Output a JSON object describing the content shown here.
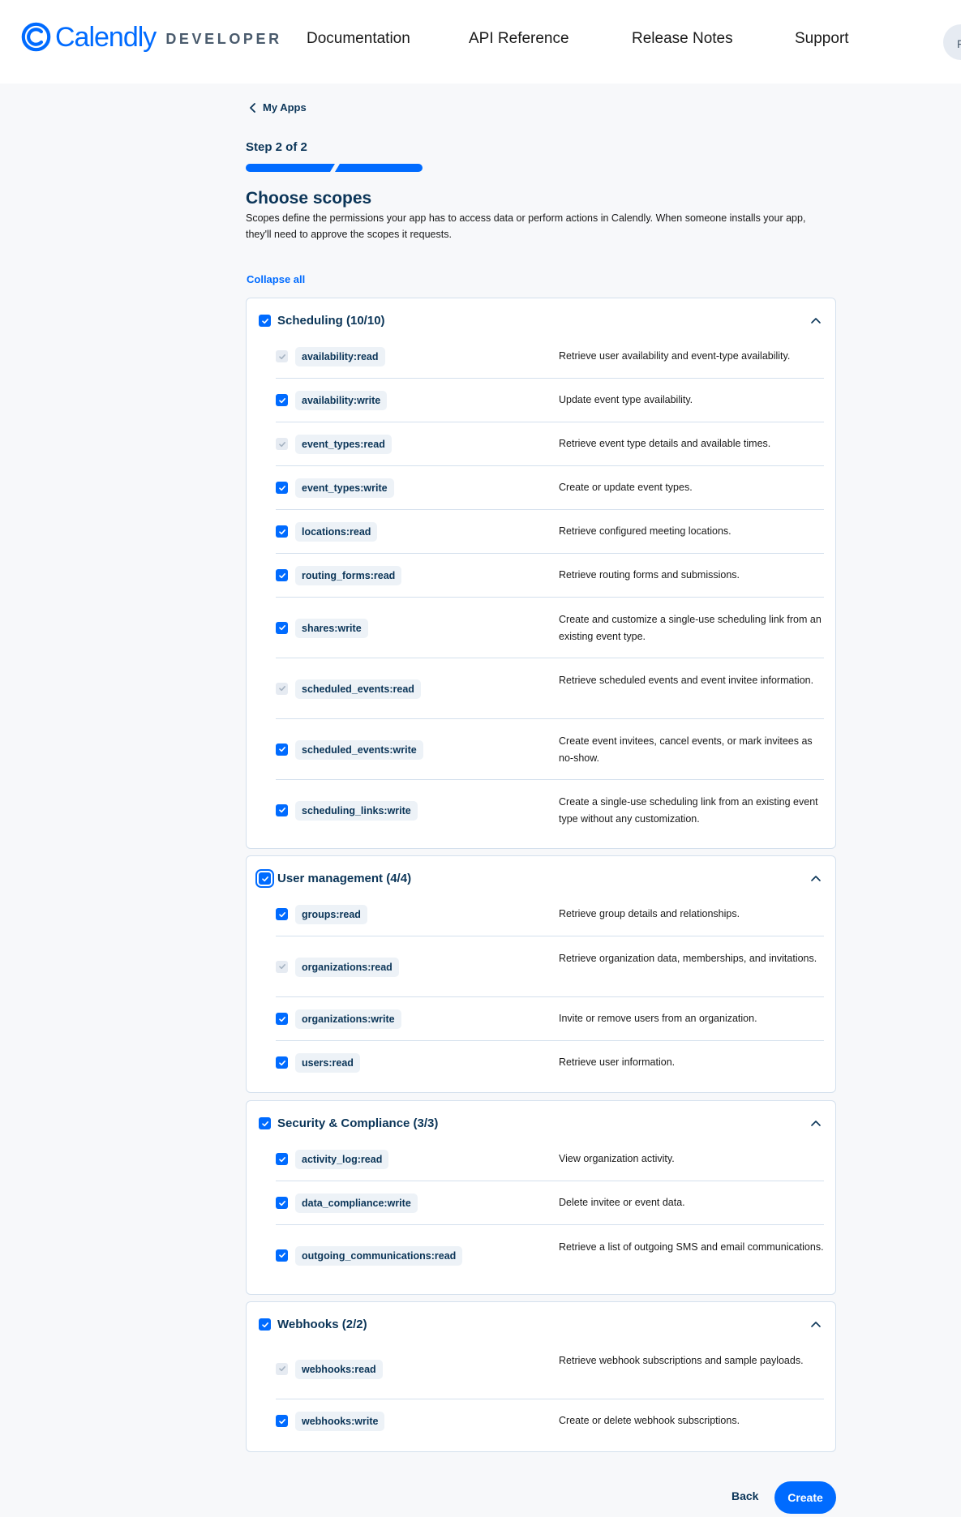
{
  "header": {
    "brand": "Calendly",
    "brand_suffix": "DEVELOPER",
    "nav": [
      "Documentation",
      "API Reference",
      "Release Notes",
      "Support"
    ],
    "avatar_initial": "F"
  },
  "breadcrumb": {
    "back_label": "My Apps"
  },
  "step": {
    "label": "Step 2 of 2",
    "current": 2,
    "total": 2
  },
  "page": {
    "title": "Choose scopes",
    "description": "Scopes define the permissions your app has to access data or perform actions in Calendly. When someone installs your app, they'll need to approve the scopes it requests.",
    "collapse_all": "Collapse all"
  },
  "sections": [
    {
      "title": "Scheduling (10/10)",
      "checked": true,
      "expanded": true,
      "scopes": [
        {
          "name": "availability:read",
          "description": "Retrieve user availability and event-type availability.",
          "checked": true,
          "disabled": true
        },
        {
          "name": "availability:write",
          "description": "Update event type availability.",
          "checked": true,
          "disabled": false
        },
        {
          "name": "event_types:read",
          "description": "Retrieve event type details and available times.",
          "checked": true,
          "disabled": true
        },
        {
          "name": "event_types:write",
          "description": "Create or update event types.",
          "checked": true,
          "disabled": false
        },
        {
          "name": "locations:read",
          "description": "Retrieve configured meeting locations.",
          "checked": true,
          "disabled": false
        },
        {
          "name": "routing_forms:read",
          "description": "Retrieve routing forms and submissions.",
          "checked": true,
          "disabled": false
        },
        {
          "name": "shares:write",
          "description": "Create and customize a single-use scheduling link from an existing event type.",
          "checked": true,
          "disabled": false
        },
        {
          "name": "scheduled_events:read",
          "description": "Retrieve scheduled events and event invitee information.",
          "checked": true,
          "disabled": true
        },
        {
          "name": "scheduled_events:write",
          "description": "Create event invitees, cancel events, or mark invitees as no-show.",
          "checked": true,
          "disabled": false
        },
        {
          "name": "scheduling_links:write",
          "description": "Create a single-use scheduling link from an existing event type without any customization.",
          "checked": true,
          "disabled": false
        }
      ]
    },
    {
      "title": "User management (4/4)",
      "checked": true,
      "expanded": true,
      "scopes": [
        {
          "name": "groups:read",
          "description": "Retrieve group details and relationships.",
          "checked": true,
          "disabled": false
        },
        {
          "name": "organizations:read",
          "description": "Retrieve organization data, memberships, and invitations.",
          "checked": true,
          "disabled": true
        },
        {
          "name": "organizations:write",
          "description": "Invite or remove users from an organization.",
          "checked": true,
          "disabled": false
        },
        {
          "name": "users:read",
          "description": "Retrieve user information.",
          "checked": true,
          "disabled": false
        }
      ]
    },
    {
      "title": "Security & Compliance (3/3)",
      "checked": true,
      "expanded": true,
      "scopes": [
        {
          "name": "activity_log:read",
          "description": "View organization activity.",
          "checked": true,
          "disabled": false
        },
        {
          "name": "data_compliance:write",
          "description": "Delete invitee or event data.",
          "checked": true,
          "disabled": false
        },
        {
          "name": "outgoing_communications:read",
          "description": "Retrieve a list of outgoing SMS and email communications.",
          "checked": true,
          "disabled": false
        }
      ]
    },
    {
      "title": "Webhooks (2/2)",
      "checked": true,
      "expanded": true,
      "scopes": [
        {
          "name": "webhooks:read",
          "description": "Retrieve webhook subscriptions and sample payloads.",
          "checked": true,
          "disabled": true
        },
        {
          "name": "webhooks:write",
          "description": "Create or delete webhook subscriptions.",
          "checked": true,
          "disabled": false
        }
      ]
    }
  ],
  "footer": {
    "back_label": "Back",
    "create_label": "Create"
  },
  "colors": {
    "accent": "#006bff",
    "text": "#0b3558",
    "border": "#d4e0ed",
    "tag_bg": "#edf2f7"
  }
}
